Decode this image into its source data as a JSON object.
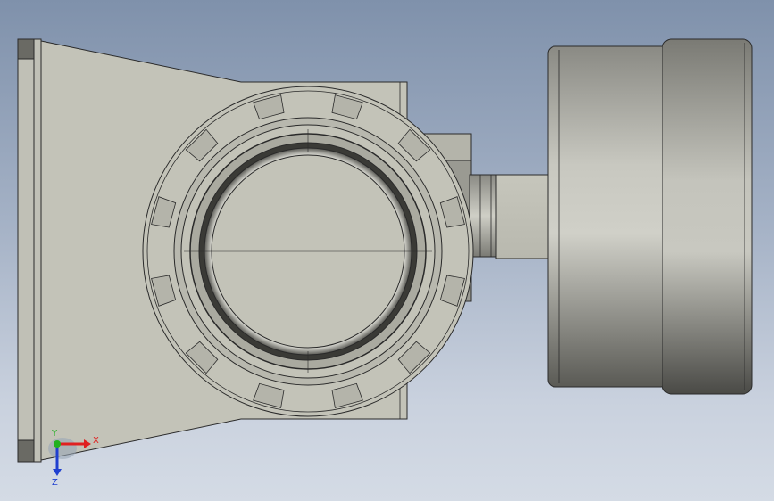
{
  "viewport": {
    "background_top": "#7f91ab",
    "background_bottom": "#d4dbe5"
  },
  "triad": {
    "x_label": "X",
    "y_label": "Y",
    "z_label": "Z",
    "x_color": "#e02020",
    "y_color": "#20b020",
    "z_color": "#2040d0"
  },
  "model": {
    "body_color": "#c3c3b8",
    "edge_color": "#2a2a2a"
  }
}
